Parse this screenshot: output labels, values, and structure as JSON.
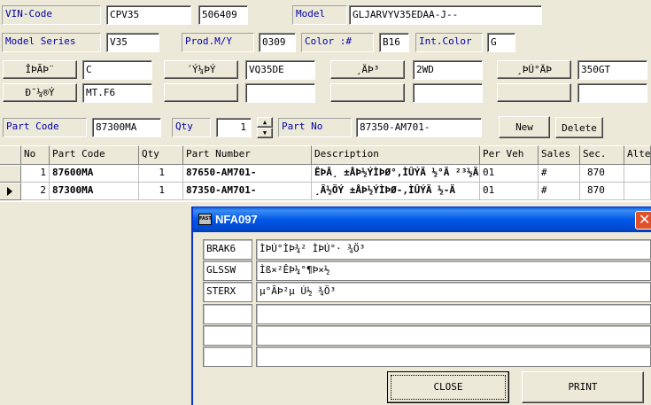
{
  "header": {
    "vin_label": "VIN-Code",
    "vin_value_1": "CPV35",
    "vin_value_2": "506409",
    "model_label": "Model",
    "model_value": "GLJARVYV35EDAA-J--",
    "series_label": "Model Series",
    "series_value": "V35",
    "prod_label": "Prod.M/Y",
    "prod_value": "0309",
    "color_label": "Color :#",
    "color_value": "B16",
    "intcolor_label": "Int.Color",
    "intcolor_value": "G"
  },
  "spec": {
    "row1": [
      {
        "label": "ÎÞÃÞ¨",
        "value": "C"
      },
      {
        "label": "´Ý¼ÞÝ",
        "value": "VQ35DE"
      },
      {
        "label": "¸ÄÞ³",
        "value": "2WD"
      },
      {
        "label": "¸ÞÚ°ÄÞ",
        "value": "350GT"
      }
    ],
    "row2": [
      {
        "label": "Ð¯¼®Ý",
        "value": "MT.F6"
      },
      {
        "label": "",
        "value": ""
      },
      {
        "label": "",
        "value": ""
      },
      {
        "label": "",
        "value": ""
      }
    ]
  },
  "part_entry": {
    "part_code_label": "Part Code",
    "part_code_value": "87300MA",
    "qty_label": "Qty",
    "qty_value": "1",
    "part_no_label": "Part No",
    "part_no_value": "87350-AM701-",
    "new_label": "New",
    "delete_label": "Delete"
  },
  "grid": {
    "columns": [
      "No",
      "Part Code",
      "Qty",
      "Part Number",
      "Description",
      "Per Veh",
      "Sales",
      "Sec.",
      "Alte"
    ],
    "rows": [
      {
        "no": "1",
        "code": "87600MA",
        "qty": "1",
        "number": "87650-AM701-",
        "desc": "ÊÞÂ¸ ±ÅÞ½ÝÌÞØ°,ÌÛÝÄ ½°Ä ²³½Ä",
        "per": "01",
        "sales": "#",
        "sec": "870"
      },
      {
        "no": "2",
        "code": "87300MA",
        "qty": "1",
        "number": "87350-AM701-",
        "desc": "¸Ä½ÖÝ ±ÅÞ½ÝÌÞØ-,ÌÛÝÄ ½-Ä",
        "per": "01",
        "sales": "#",
        "sec": "870"
      }
    ]
  },
  "dialog": {
    "title": "NFA097",
    "icon_text": "FAST",
    "rows": [
      {
        "code": "BRAK6",
        "desc": "ÌÞÚ°ÌÞ¾² ÌÞÚ°· ¾Ö³"
      },
      {
        "code": "GLSSW",
        "desc": "Ìß×²ÊÞ¼°¶Þ×½"
      },
      {
        "code": "STERX",
        "desc": "µ°ÃÞ²µ Ú½ ¾Ö³"
      },
      {
        "code": "",
        "desc": ""
      },
      {
        "code": "",
        "desc": ""
      },
      {
        "code": "",
        "desc": ""
      }
    ],
    "close_label": "CLOSE",
    "print_label": "PRINT"
  }
}
